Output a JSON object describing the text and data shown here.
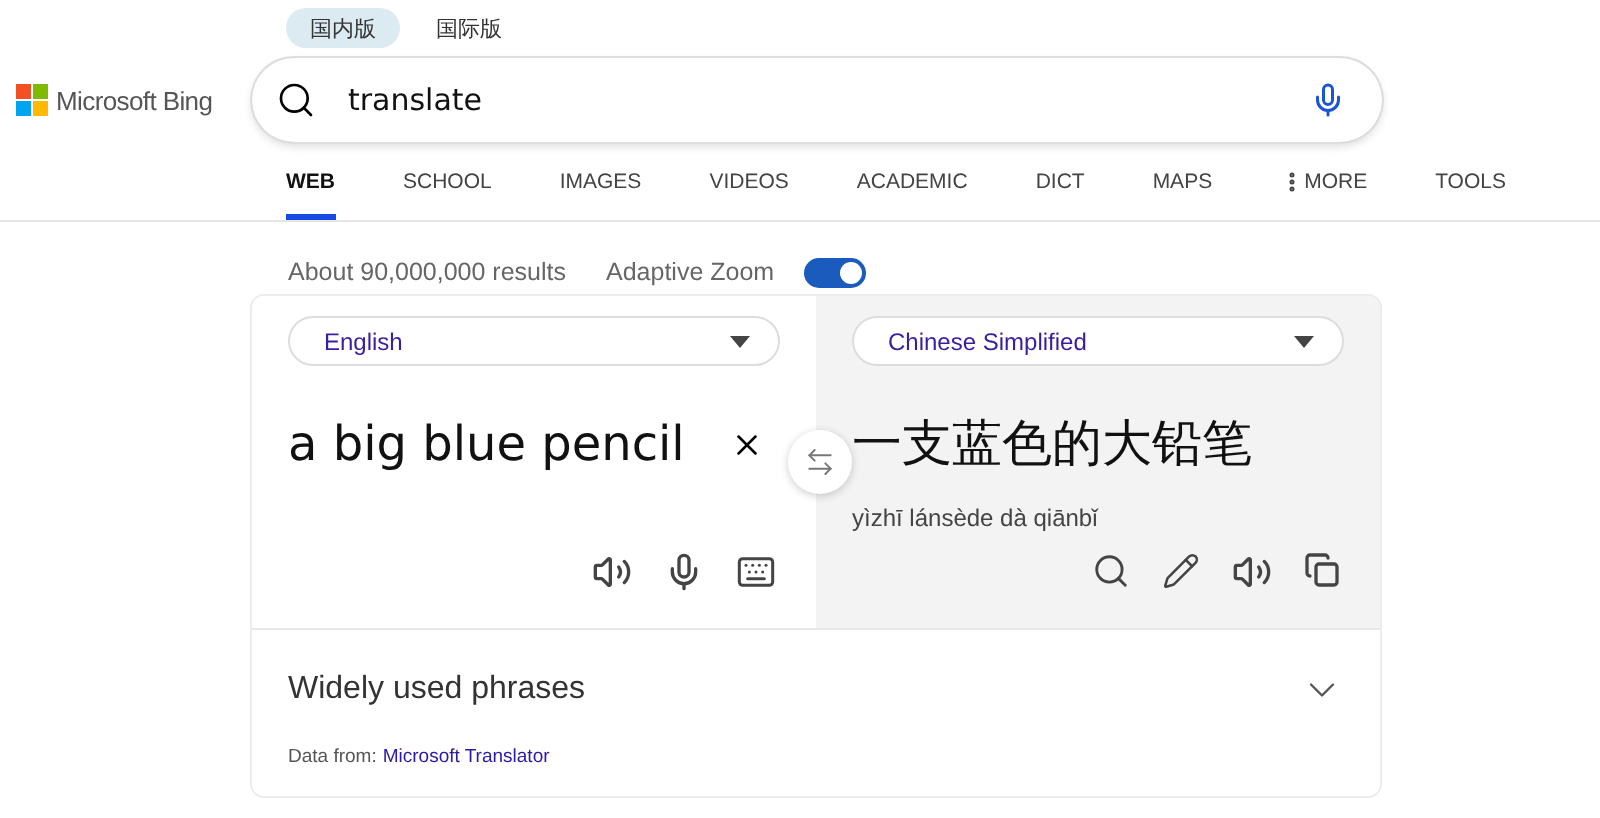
{
  "market_tabs": [
    {
      "label": "国内版",
      "selected": true
    },
    {
      "label": "国际版",
      "selected": false
    }
  ],
  "logo": {
    "text": "Microsoft Bing"
  },
  "search": {
    "value": "translate"
  },
  "nav": [
    {
      "label": "WEB",
      "selected": true,
      "kind": "link"
    },
    {
      "label": "SCHOOL",
      "selected": false,
      "kind": "link"
    },
    {
      "label": "IMAGES",
      "selected": false,
      "kind": "link"
    },
    {
      "label": "VIDEOS",
      "selected": false,
      "kind": "link"
    },
    {
      "label": "ACADEMIC",
      "selected": false,
      "kind": "link"
    },
    {
      "label": "DICT",
      "selected": false,
      "kind": "link"
    },
    {
      "label": "MAPS",
      "selected": false,
      "kind": "link"
    },
    {
      "label": "MORE",
      "selected": false,
      "kind": "menu"
    },
    {
      "label": "TOOLS",
      "selected": false,
      "kind": "link"
    }
  ],
  "results_count": "About 90,000,000 results",
  "adaptive_zoom": {
    "label": "Adaptive Zoom",
    "on": true
  },
  "translator": {
    "source_language": "English",
    "target_language": "Chinese Simplified",
    "source_text": "a big blue pencil",
    "translation": "一支蓝色的大铅笔",
    "pinyin": "yìzhī lánsède dà qiānbǐ"
  },
  "phrases": {
    "label": "Widely used phrases",
    "expanded": false
  },
  "attribution": {
    "prefix": "Data from:",
    "link": "Microsoft Translator"
  }
}
